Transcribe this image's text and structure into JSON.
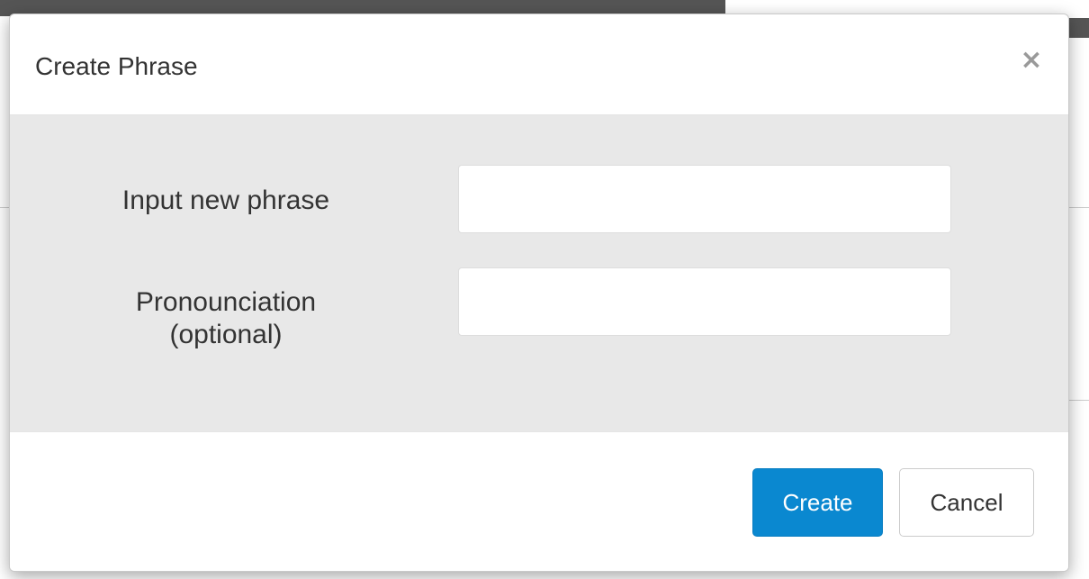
{
  "modal": {
    "title": "Create Phrase",
    "close_glyph": "×",
    "close_icon": "close-icon",
    "fields": [
      {
        "label": "Input new phrase",
        "value": "",
        "placeholder": ""
      },
      {
        "label": "Pronounciation\n(optional)",
        "value": "",
        "placeholder": ""
      }
    ],
    "buttons": {
      "create_label": "Create",
      "cancel_label": "Cancel"
    }
  },
  "colors": {
    "primary": "#0a88d0",
    "body_bg": "#e8e8e8",
    "overlay": "#7a7a7a"
  }
}
